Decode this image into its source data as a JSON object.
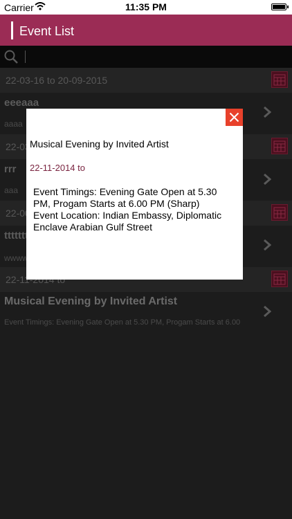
{
  "status": {
    "carrier": "Carrier",
    "time": "11:35 PM"
  },
  "navbar": {
    "title": "Event List"
  },
  "list": {
    "items": [
      {
        "date": "22-03-16 to 20-09-2015",
        "title": "eeeaaa",
        "subtitle": "aaaa"
      },
      {
        "date": "22-03-16 to",
        "title": "rrr",
        "subtitle": "aaa"
      },
      {
        "date": "22-00-16 to",
        "title": "tttttttt",
        "subtitle": "wwwwwwwww"
      },
      {
        "date": "22-11-2014 to",
        "title": "Musical Evening by Invited Artist",
        "subtitle": "Event Timings: Evening Gate Open at 5.30 PM, Progam Starts at 6.00"
      }
    ]
  },
  "modal": {
    "title": "Musical Evening by Invited Artist",
    "date": "22-11-2014 to",
    "description": "Event Timings: Evening Gate Open at 5.30 PM, Progam Starts at 6.00 PM (Sharp)\nEvent Location: Indian Embassy, Diplomatic Enclave Arabian Gulf Street"
  },
  "colors": {
    "navbar": "#9b2c55",
    "close": "#e8412b",
    "date_accent": "#7a2440"
  }
}
